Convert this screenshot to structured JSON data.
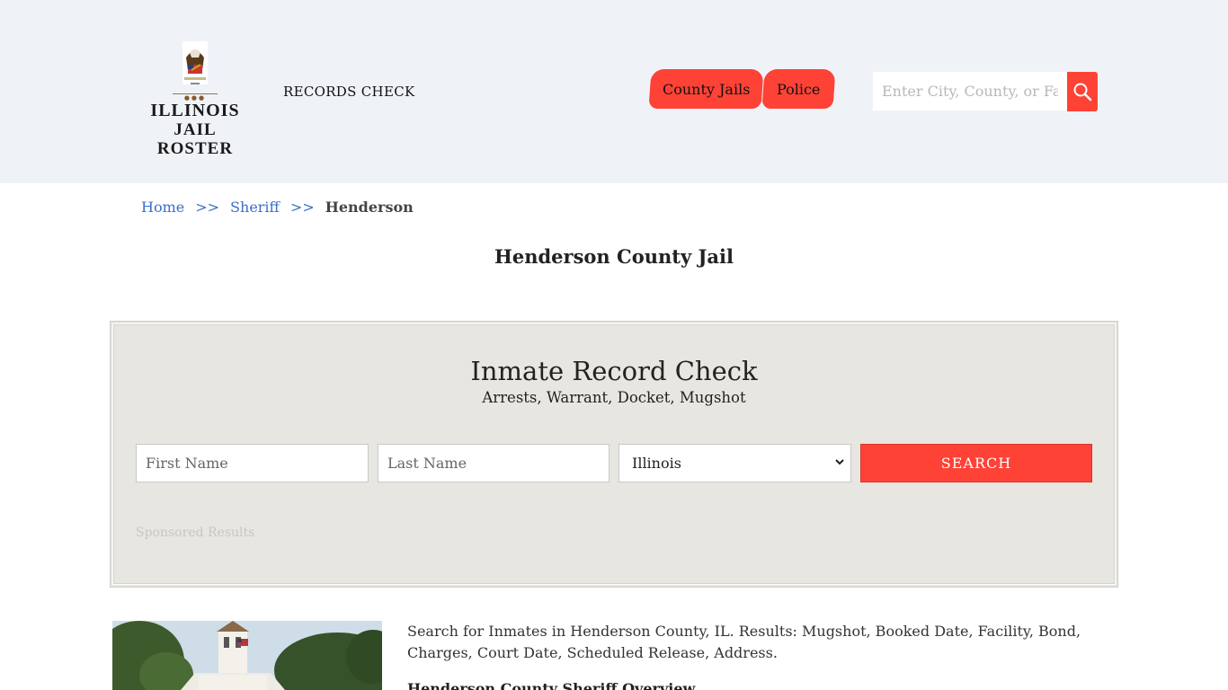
{
  "header": {
    "logo": {
      "line1": "ILLINOIS",
      "line2": "JAIL ROSTER",
      "seal_icon": "illinois-state-seal-icon"
    },
    "records_check": "RECORDS CHECK",
    "nav": [
      {
        "label": "County Jails"
      },
      {
        "label": "Police"
      }
    ],
    "search": {
      "placeholder": "Enter City, County, or Facility",
      "icon": "search-icon"
    }
  },
  "breadcrumb": {
    "items": [
      "Home",
      "Sheriff",
      "Henderson"
    ],
    "separator": ">>"
  },
  "page_title": "Henderson County Jail",
  "record_check": {
    "title": "Inmate Record Check",
    "subtitle": "Arrests, Warrant, Docket, Mugshot",
    "first_name_placeholder": "First Name",
    "last_name_placeholder": "Last Name",
    "state_selected": "Illinois",
    "submit_label": "SEARCH",
    "sponsored": "Sponsored Results"
  },
  "content": {
    "intro": "Search for Inmates in Henderson County, IL. Results: Mugshot, Booked Date, Facility, Bond, Charges, Court Date, Scheduled Release, Address.",
    "subheading": "Henderson County Sheriff Overview"
  },
  "colors": {
    "accent": "#ff4236",
    "header_bg": "#eff3f8",
    "panel_bg": "#e8e6e1",
    "link": "#3a6fc9"
  }
}
